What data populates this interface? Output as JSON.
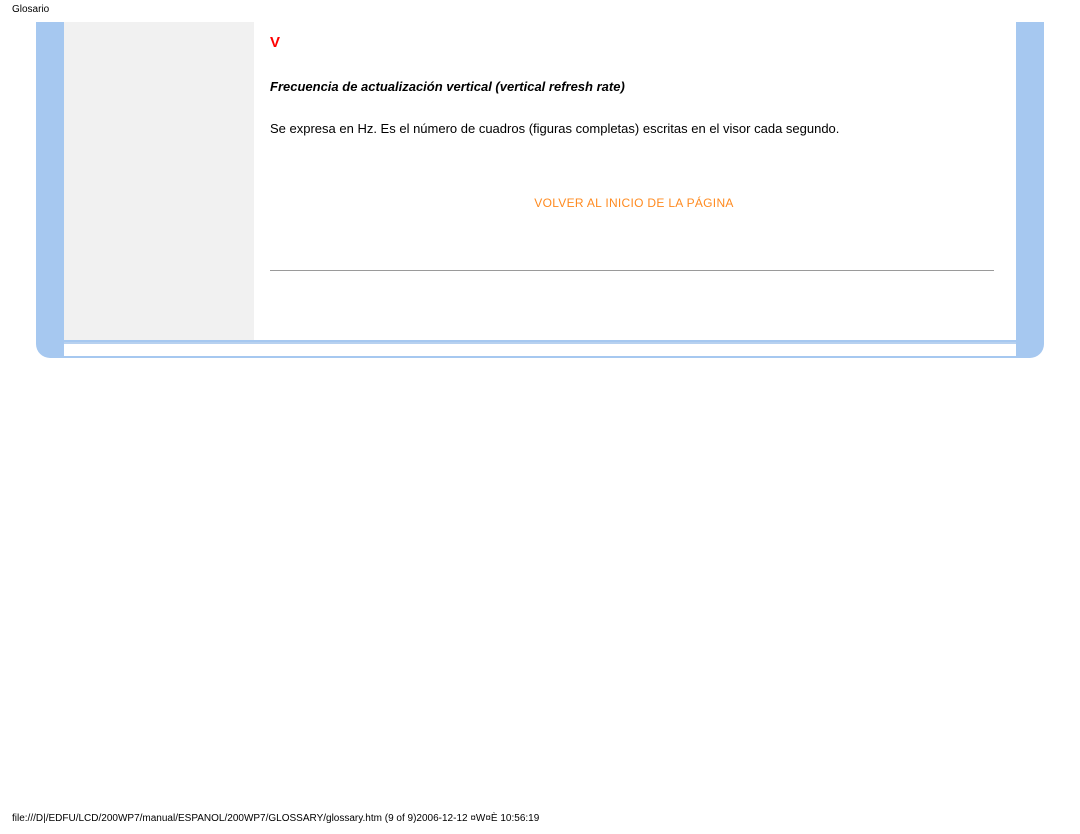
{
  "header": {
    "title": "Glosario"
  },
  "glossary": {
    "section_letter": "V",
    "term_heading": "Frecuencia de actualización vertical (vertical refresh rate)",
    "term_body": "Se expresa en Hz. Es el número de cuadros (figuras completas) escritas en el visor cada segundo.",
    "back_to_top": "VOLVER AL INICIO DE LA PÁGINA"
  },
  "footer": {
    "path": "file:///D|/EDFU/LCD/200WP7/manual/ESPANOL/200WP7/GLOSSARY/glossary.htm (9 of 9)2006-12-12 ¤W¤È 10:56:19"
  }
}
